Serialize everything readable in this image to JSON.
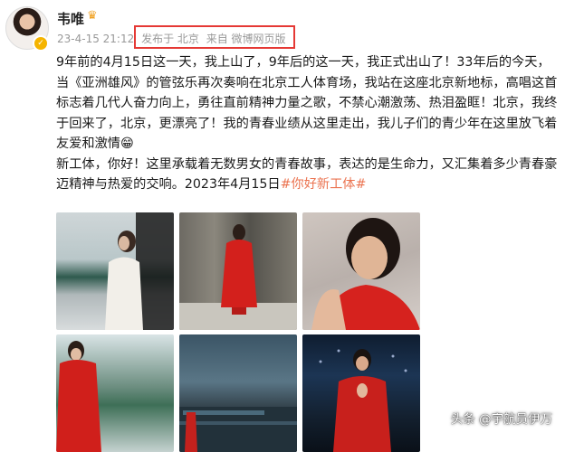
{
  "user": {
    "name": "韦唯",
    "avatar_icon": "user-avatar",
    "badge_icon": "crown-icon"
  },
  "meta": {
    "timestamp": "23-4-15 21:12",
    "location": "发布于 北京",
    "source": "来自 微博网页版"
  },
  "post": {
    "paragraph1": "9年前的4月15日这一天，我上山了，9年后的这一天，我正式出山了！33年后的今天，当《亚洲雄风》的管弦乐再次奏响在北京工人体育场，我站在这座北京新地标，高唱这首标志着几代人奋力向上，勇往直前精神力量之歌，不禁心潮激荡、热泪盈眶！北京，我终于回来了，北京，更漂亮了！我的青春业绩从这里走出，我儿子们的青少年在这里放飞着友爱和激情",
    "emoji": "😁",
    "paragraph2": "新工体，你好！这里承载着无数男女的青春故事，表达的是生命力，又汇集着多少青春豪迈精神与热爱的交响。2023年4月15日",
    "hashtag": "#你好新工体#"
  },
  "photos": [
    {
      "label": "photo-1"
    },
    {
      "label": "photo-2"
    },
    {
      "label": "photo-3"
    },
    {
      "label": "photo-4"
    },
    {
      "label": "photo-5"
    },
    {
      "label": "photo-6"
    }
  ],
  "watermark": "头条 @宇航员伊万",
  "colors": {
    "hashtag": "#eb7350",
    "highlight_box": "#e53935",
    "verify": "#f5b400"
  }
}
